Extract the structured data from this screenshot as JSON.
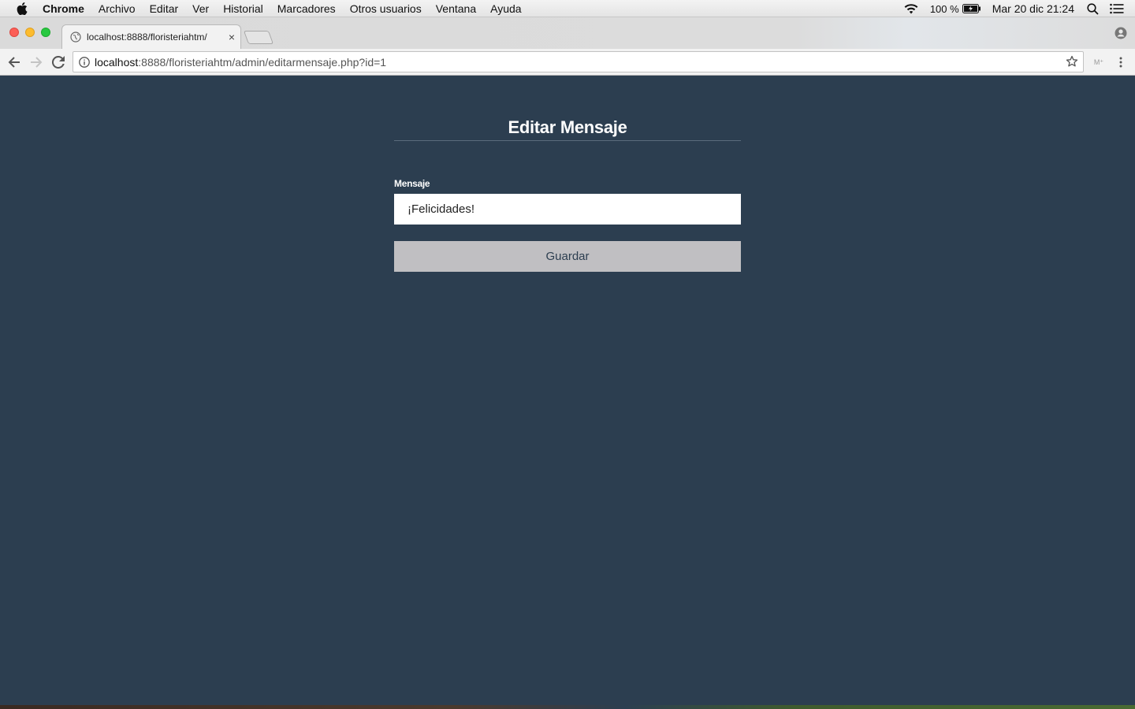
{
  "menubar": {
    "app_name": "Chrome",
    "items": [
      "Archivo",
      "Editar",
      "Ver",
      "Historial",
      "Marcadores",
      "Otros usuarios",
      "Ventana",
      "Ayuda"
    ],
    "battery_text": "100 %",
    "clock": "Mar 20 dic  21:24"
  },
  "browser": {
    "tab_title": "localhost:8888/floristeriahtm/",
    "tab_close": "×",
    "url_host": "localhost",
    "url_path": ":8888/floristeriahtm/admin/editarmensaje.php?id=1",
    "extension_label": "M⁺"
  },
  "page": {
    "title": "Editar Mensaje",
    "field_label": "Mensaje",
    "field_value": "¡Felicidades!",
    "save_label": "Guardar",
    "background_color": "#2c3e50",
    "button_color": "#c0bfc2"
  }
}
